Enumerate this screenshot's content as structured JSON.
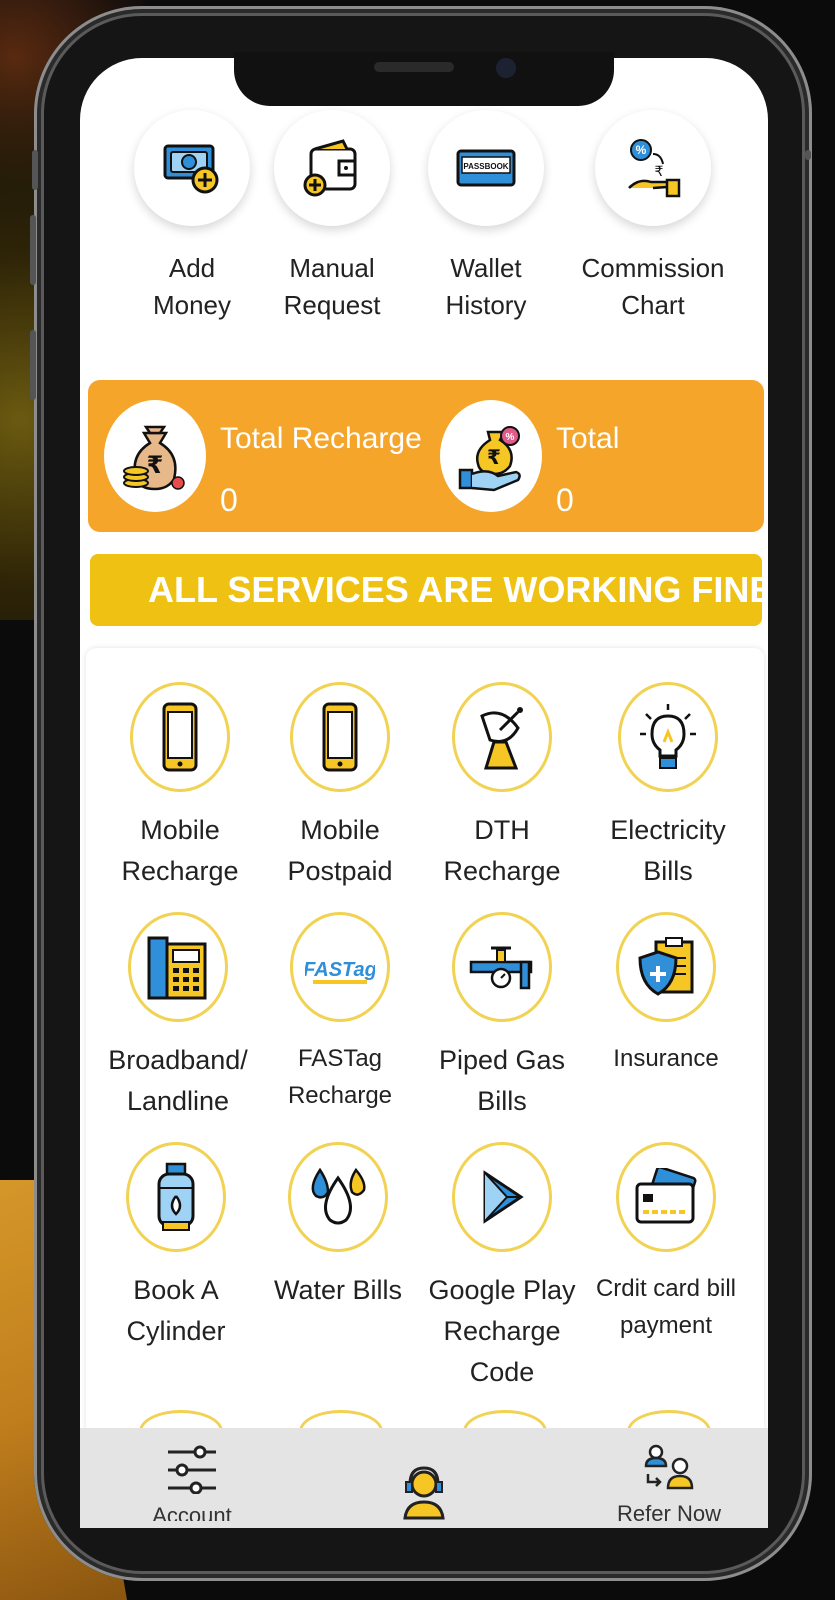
{
  "quick_actions": [
    {
      "label": "Add Money",
      "line1": "Add",
      "line2": "Money",
      "icon": "add-money-icon"
    },
    {
      "label": "Manual Request",
      "line1": "Manual",
      "line2": "Request",
      "icon": "wallet-icon"
    },
    {
      "label": "Wallet History",
      "line1": "Wallet",
      "line2": "History",
      "icon": "passbook-icon",
      "badge": "PASSBOOK"
    },
    {
      "label": "Commission Chart",
      "line1": "Commission",
      "line2": "Chart",
      "icon": "commission-hand-icon"
    }
  ],
  "summary": {
    "total_recharge": {
      "title": "Total Recharge",
      "value": "0"
    },
    "total": {
      "title": "Total",
      "value": "0"
    }
  },
  "banner": {
    "text": "ALL SERVICES ARE WORKING FINE.!"
  },
  "services": [
    {
      "line1": "Mobile",
      "line2": "Recharge",
      "icon": "mobile-icon"
    },
    {
      "line1": "Mobile",
      "line2": "Postpaid",
      "icon": "mobile-icon"
    },
    {
      "line1": "DTH",
      "line2": "Recharge",
      "icon": "satellite-dish-icon"
    },
    {
      "line1": "Electricity",
      "line2": "Bills",
      "icon": "bulb-icon"
    },
    {
      "line1": "Broadband/",
      "line2": "Landline",
      "icon": "landline-phone-icon"
    },
    {
      "line1": "FASTag",
      "line2": "Recharge",
      "icon": "fastag-icon",
      "badge": "FASTag"
    },
    {
      "line1": "Piped Gas",
      "line2": "Bills",
      "icon": "gas-pipe-icon"
    },
    {
      "line1": "Insurance",
      "line2": "",
      "icon": "insurance-shield-icon"
    },
    {
      "line1": "Book A",
      "line2": "Cylinder",
      "icon": "gas-cylinder-icon"
    },
    {
      "line1": "Water Bills",
      "line2": "",
      "icon": "water-drops-icon"
    },
    {
      "line1": "Google Play",
      "line2": "Recharge",
      "line3": "Code",
      "icon": "play-store-icon"
    },
    {
      "line1": "Crdit card bill",
      "line2": "payment",
      "icon": "credit-card-icon"
    }
  ],
  "bottom_nav": {
    "account": {
      "label": "Account",
      "icon": "sliders-icon"
    },
    "support": {
      "label": "",
      "icon": "support-agent-icon"
    },
    "refer": {
      "label": "Refer Now",
      "icon": "refer-users-icon"
    }
  },
  "colors": {
    "accent_orange": "#f4a52a",
    "banner_yellow": "#eec112",
    "ring_yellow": "#f1d253",
    "icon_blue": "#2f8fd8"
  }
}
